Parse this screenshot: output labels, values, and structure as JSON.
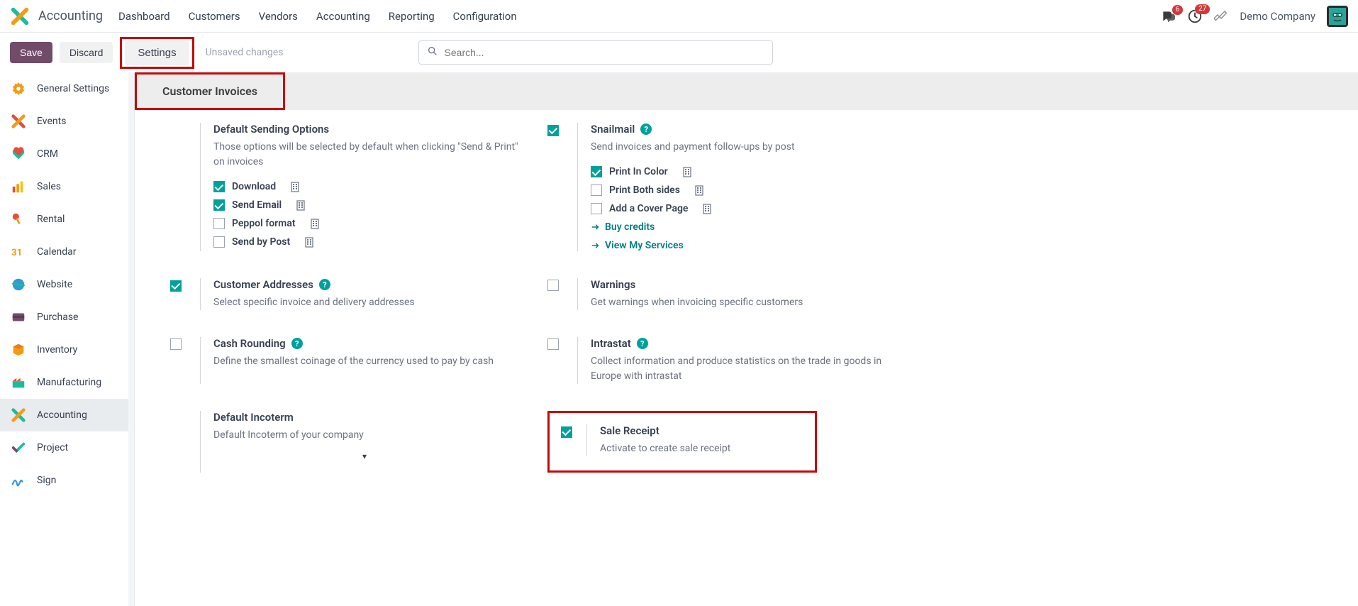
{
  "brand": "Accounting",
  "topmenu": [
    "Dashboard",
    "Customers",
    "Vendors",
    "Accounting",
    "Reporting",
    "Configuration"
  ],
  "badges": {
    "chat": "6",
    "clock": "27"
  },
  "company": "Demo Company",
  "buttons": {
    "save": "Save",
    "discard": "Discard",
    "settings": "Settings"
  },
  "unsaved": "Unsaved changes",
  "search_placeholder": "Search...",
  "sidebar": [
    {
      "label": "General Settings"
    },
    {
      "label": "Events"
    },
    {
      "label": "CRM"
    },
    {
      "label": "Sales"
    },
    {
      "label": "Rental"
    },
    {
      "label": "Calendar"
    },
    {
      "label": "Website"
    },
    {
      "label": "Purchase"
    },
    {
      "label": "Inventory"
    },
    {
      "label": "Manufacturing"
    },
    {
      "label": "Accounting"
    },
    {
      "label": "Project"
    },
    {
      "label": "Sign"
    }
  ],
  "section_title": "Customer Invoices",
  "settings": {
    "default_sending": {
      "title": "Default Sending Options",
      "desc": "Those options will be selected by default when clicking \"Send & Print\" on invoices",
      "opts": {
        "download": "Download",
        "send_email": "Send Email",
        "peppol": "Peppol format",
        "send_post": "Send by Post"
      }
    },
    "snailmail": {
      "title": "Snailmail",
      "desc": "Send invoices and payment follow-ups by post",
      "opts": {
        "color": "Print In Color",
        "both": "Print Both sides",
        "cover": "Add a Cover Page"
      },
      "links": {
        "buy": "Buy credits",
        "view": "View My Services"
      }
    },
    "customer_addresses": {
      "title": "Customer Addresses",
      "desc": "Select specific invoice and delivery addresses"
    },
    "warnings": {
      "title": "Warnings",
      "desc": "Get warnings when invoicing specific customers"
    },
    "cash_rounding": {
      "title": "Cash Rounding",
      "desc": "Define the smallest coinage of the currency used to pay by cash"
    },
    "intrastat": {
      "title": "Intrastat",
      "desc": "Collect information and produce statistics on the trade in goods in Europe with intrastat"
    },
    "default_incoterm": {
      "title": "Default Incoterm",
      "desc": "Default Incoterm of your company"
    },
    "sale_receipt": {
      "title": "Sale Receipt",
      "desc": "Activate to create sale receipt"
    }
  }
}
